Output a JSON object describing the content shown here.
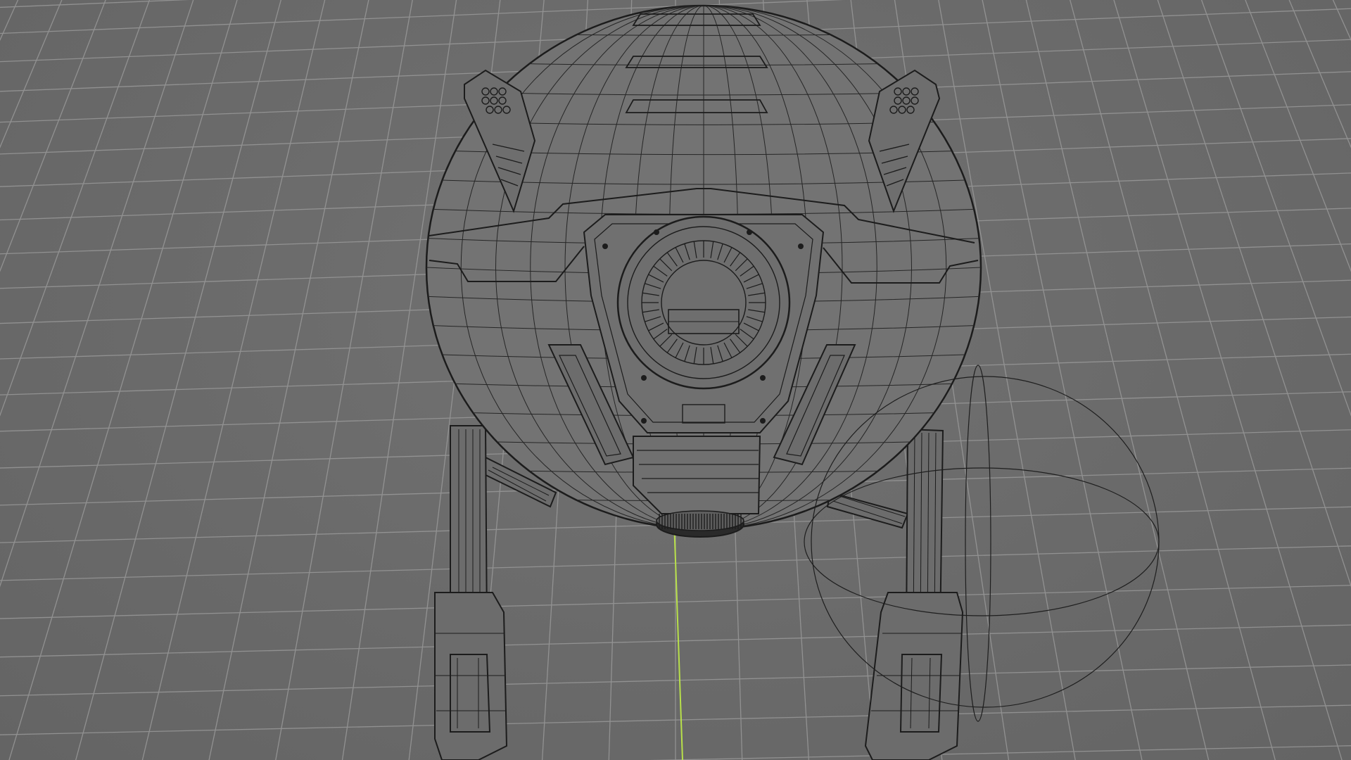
{
  "viewport": {
    "kind": "3d-viewport-wireframe",
    "background_color": "#6b6b6b",
    "grid_color": "#9c9c9c",
    "wire_color": "#1c1c1c",
    "axis_color": "#b8e04a"
  },
  "scene": {
    "object": "spherical-walker-robot",
    "display_mode": "wireframe",
    "gizmo": "rotation-ellipse-gizmo"
  }
}
